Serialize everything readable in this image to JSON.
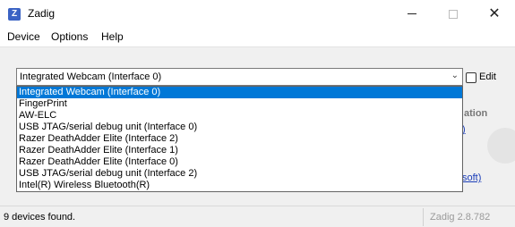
{
  "window": {
    "icon_letter": "Z",
    "title": "Zadig",
    "close_glyph": "✕"
  },
  "menu": {
    "items": [
      "Device",
      "Options",
      "Help"
    ]
  },
  "device_selector": {
    "selected": "Integrated Webcam (Interface 0)",
    "arrow_glyph": "⌄",
    "edit_label": "Edit",
    "options": [
      "Integrated Webcam (Interface 0)",
      "FingerPrint",
      "AW-ELC",
      "USB JTAG/serial debug unit (Interface 0)",
      "Razer DeathAdder Elite (Interface 2)",
      "Razer DeathAdder Elite (Interface 1)",
      "Razer DeathAdder Elite (Interface 0)",
      "USB JTAG/serial debug unit (Interface 2)",
      "Intel(R) Wireless Bluetooth(R)"
    ]
  },
  "background": {
    "partial_heading": "ation",
    "partial_link_top": ")",
    "partial_link_bottom": "soft)"
  },
  "status": {
    "message": "9 devices found.",
    "version": "Zadig 2.8.782"
  }
}
